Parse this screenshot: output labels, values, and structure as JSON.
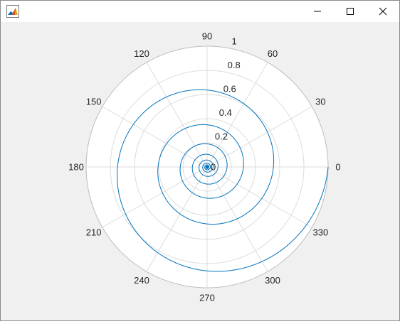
{
  "window": {
    "icon": "matlab-figure-icon",
    "buttons": {
      "minimize": "minimize-icon",
      "maximize": "maximize-icon",
      "close": "close-icon"
    }
  },
  "colors": {
    "background": "#f0f0f0",
    "axes_background": "#ffffff",
    "grid": "#dcdcdc",
    "series": "#0072bd",
    "text": "#262626"
  },
  "chart_data": {
    "type": "line",
    "coordinate_system": "polar",
    "title": "",
    "theta_zero_location": "right",
    "theta_direction": "counterclockwise",
    "theta_ticks": [
      0,
      30,
      60,
      90,
      120,
      150,
      180,
      210,
      240,
      270,
      300,
      330
    ],
    "theta_tick_labels": [
      "0",
      "30",
      "60",
      "90",
      "120",
      "150",
      "180",
      "210",
      "240",
      "270",
      "300",
      "330"
    ],
    "r_ticks": [
      0,
      0.2,
      0.4,
      0.6,
      0.8,
      1
    ],
    "r_tick_labels": [
      "0",
      "0.2",
      "0.4",
      "0.6",
      "0.8",
      "1"
    ],
    "rlim": [
      0,
      1
    ],
    "r_label_angle_deg": 80,
    "grid": true,
    "series": [
      {
        "description": "exponential spiral r = exp(k*theta), spiraling inward counterclockwise",
        "theta_range_deg": [
          -3600,
          0
        ],
        "r_at_theta_0": 1.0,
        "r_decay_per_turn": 0.548,
        "color": "#0072bd"
      }
    ]
  }
}
